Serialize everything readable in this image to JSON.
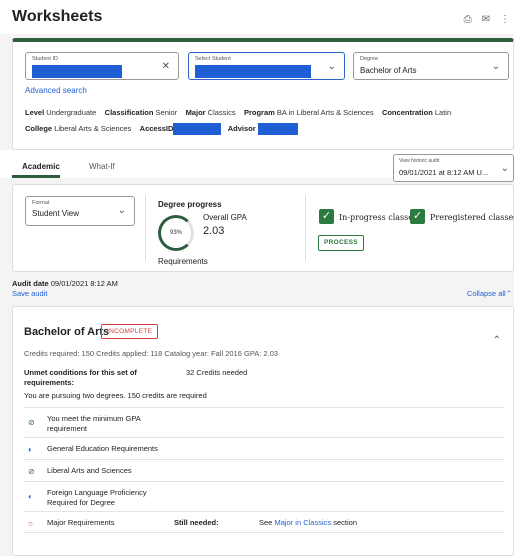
{
  "page": {
    "title": "Worksheets"
  },
  "header_icons": [
    "print-icon",
    "mail-icon",
    "more-icon"
  ],
  "student": {
    "id_label": "Student ID",
    "select_label": "Select Student",
    "degree_label": "Degree",
    "degree_value": "Bachelor of Arts",
    "advanced_search": "Advanced search",
    "level_label": "Level",
    "level_value": "Undergraduate",
    "classification_label": "Classification",
    "classification_value": "Senior",
    "major_label": "Major",
    "major_value": "Classics",
    "program_label": "Program",
    "program_value": "BA in Liberal Arts & Sciences",
    "concentration_label": "Concentration",
    "concentration_value": "Latin",
    "college_label": "College",
    "college_value": "Liberal Arts & Sciences",
    "accessid_label": "AccessID",
    "advisor_label": "Advisor"
  },
  "tabs": {
    "academic": "Academic",
    "whatif": "What-If"
  },
  "historic": {
    "label": "View historic audit",
    "value": "09/01/2021 at 8:12 AM U..."
  },
  "summary": {
    "format_label": "Format",
    "format_value": "Student View",
    "progress_title": "Degree progress",
    "progress_percent": "93%",
    "gpa_label": "Overall GPA",
    "gpa_value": "2.03",
    "requirements_label": "Requirements",
    "inprogress_label": "In-progress classes",
    "preregistered_label": "Preregistered classes",
    "process_label": "PROCESS"
  },
  "audit": {
    "date_label": "Audit date",
    "date_value": "09/01/2021 8:12 AM",
    "save": "Save audit",
    "collapse": "Collapse all"
  },
  "degree": {
    "title": "Bachelor of Arts",
    "status": "INCOMPLETE",
    "meta": "Credits required:  150    Credits applied:  118    Catalog year:  Fall 2016    GPA:  2.03",
    "unmet_label": "Unmet conditions for this set of requirements:",
    "unmet_value": "32 Credits needed",
    "pursuing": "You are pursuing two degrees. 150 credits are required",
    "requirements": [
      {
        "text": "You meet the minimum GPA requirement",
        "icon": "check-circle-icon"
      },
      {
        "text": "General Education Requirements",
        "icon": "half-circle-icon"
      },
      {
        "text": "Liberal Arts and Sciences",
        "icon": "check-circle-icon"
      },
      {
        "text": "Foreign Language Proficiency Required for Degree",
        "icon": "half-circle-icon"
      },
      {
        "text": "Major Requirements",
        "icon": "empty-circle-icon"
      }
    ],
    "still_needed_label": "Still needed:",
    "still_see": "See",
    "still_link": "Major in Classics",
    "still_section": "section"
  }
}
